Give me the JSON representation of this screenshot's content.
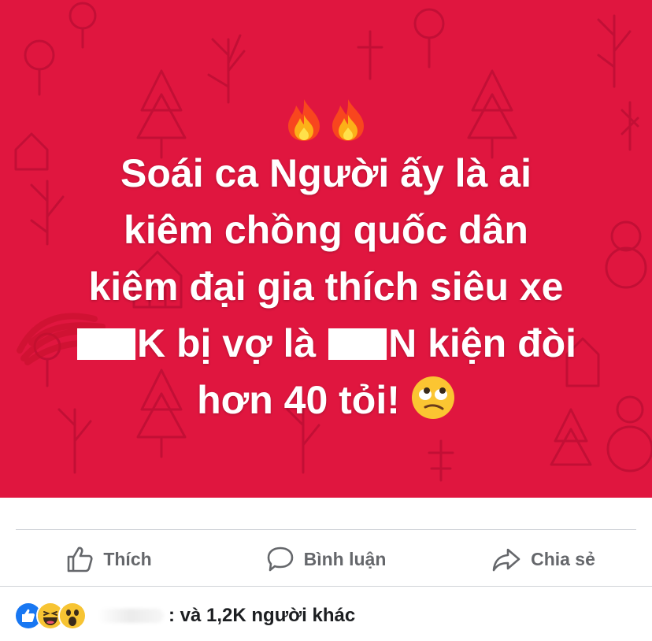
{
  "post": {
    "lines": [
      "Soái ca Người ấy là ai",
      "kiêm chồng quốc dân",
      "kiêm đại gia thích siêu xe",
      "K bị vợ là",
      "N kiện đòi",
      "hơn 40 tỏi!"
    ],
    "background_color": "#e0163f",
    "emojis": [
      "fire-emoji",
      "fire-emoji",
      "face-with-rolling-eyes-emoji"
    ]
  },
  "actions": {
    "like_label": "Thích",
    "comment_label": "Bình luận",
    "share_label": "Chia sẻ"
  },
  "reactions": {
    "icons": [
      "like",
      "haha",
      "wow"
    ],
    "summary_text": ": và 1,2K người khác"
  },
  "colors": {
    "action_text": "#65676b",
    "like_blue": "#1877f2",
    "emoji_yellow": "#f7c433"
  }
}
